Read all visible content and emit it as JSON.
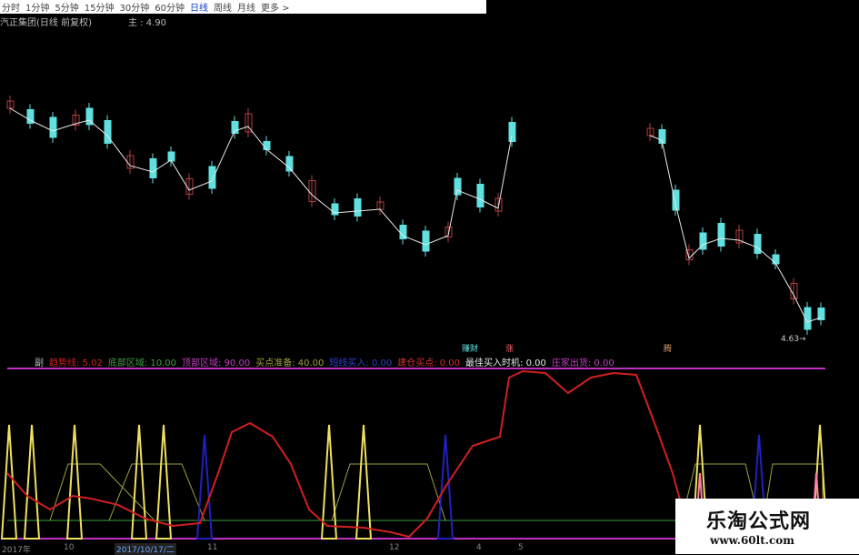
{
  "toolbar": {
    "periods": [
      "分时",
      "1分钟",
      "5分钟",
      "15分钟",
      "30分钟",
      "60分钟",
      "日线",
      "周线",
      "月线",
      "更多 >"
    ],
    "active": "日线"
  },
  "title": {
    "stock": "汽正集团(日线 前复权)",
    "main": "主 : 4.90"
  },
  "indicators": {
    "fu": "副",
    "items": [
      {
        "label": "趋势线: 5.02",
        "color": "#d02020"
      },
      {
        "label": "底部区域: 10.00",
        "color": "#40a040"
      },
      {
        "label": "顶部区域: 90.00",
        "color": "#c040c0"
      },
      {
        "label": "买点准备: 40.00",
        "color": "#a0a040"
      },
      {
        "label": "短线买入: 0.00",
        "color": "#3040d0"
      },
      {
        "label": "建仓买点: 0.00",
        "color": "#d03030"
      },
      {
        "label": "最佳买入时机: 0.00",
        "color": "#e8e8e8"
      },
      {
        "label": "庄家出货: 0.00",
        "color": "#c040c0"
      }
    ]
  },
  "markers": {
    "buy_fortune": "赚财",
    "rise": "涨",
    "tick": "腾"
  },
  "price_label": "4.63→",
  "axis": {
    "y2017": "2017年",
    "m10": "10",
    "date": "2017/10/17/二",
    "m11": "11",
    "m12": "12",
    "m4": "4",
    "m5": "5"
  },
  "watermark": {
    "cn": "乐淘公式网",
    "url": "www.60lt.com"
  },
  "colors": {
    "up": "#b04040",
    "down": "#60e0e0",
    "trend": "#d02020",
    "band_top": "#c030c0",
    "band_bottom": "#40a040",
    "spike_yellow": "#f0e060",
    "spike_blue": "#2020c0",
    "spike_pink": "#ff80a0"
  }
}
